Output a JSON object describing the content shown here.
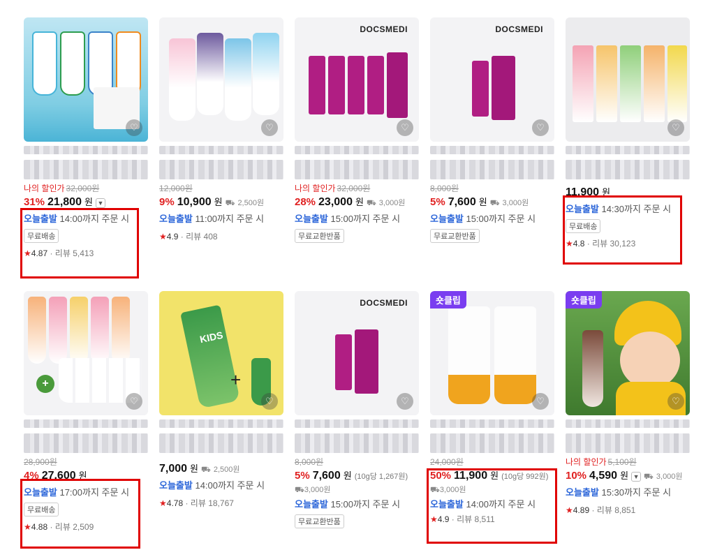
{
  "colors": {
    "discount": "#e02020",
    "today_shipping": "#2c66d9",
    "highlight": "#e00000",
    "sale_badge": "#7a3df0"
  },
  "icons": {
    "favorite": "heart-icon",
    "rating": "star-icon",
    "shipping_fee": "truck-icon",
    "option": "chevron-down-icon"
  },
  "products": [
    {
      "orig_label": "나의 할인가",
      "orig_price": "32,000원",
      "discount": "31%",
      "price": "21,800",
      "won": "원",
      "today_tag": "오늘출발",
      "today_text": "14:00까지 주문 시",
      "chip": "무료배송",
      "star": "★",
      "rating": "4.87",
      "reviews": "리뷰 5,413"
    },
    {
      "orig_price": "12,000원",
      "discount": "9%",
      "price": "10,900",
      "won": "원",
      "shipping": "2,500원",
      "today_tag": "오늘출발",
      "today_text": "11:00까지 주문 시",
      "star": "★",
      "rating": "4.9",
      "reviews": "리뷰 408"
    },
    {
      "brand": "DOCSMEDI",
      "orig_label": "나의 할인가",
      "orig_price": "32,000원",
      "discount": "28%",
      "price": "23,000",
      "won": "원",
      "shipping": "3,000원",
      "today_tag": "오늘출발",
      "today_text": "15:00까지 주문 시",
      "chip": "무료교환반품"
    },
    {
      "brand": "DOCSMEDI",
      "orig_price": "8,000원",
      "discount": "5%",
      "price": "7,600",
      "won": "원",
      "shipping": "3,000원",
      "today_tag": "오늘출발",
      "today_text": "15:00까지 주문 시",
      "chip": "무료교환반품"
    },
    {
      "price": "11,900",
      "won": "원",
      "today_tag": "오늘출발",
      "today_text": "14:30까지 주문 시",
      "chip": "무료배송",
      "star": "★",
      "rating": "4.8",
      "reviews": "리뷰 30,123"
    },
    {
      "orig_price": "28,900원",
      "discount": "4%",
      "price": "27,600",
      "won": "원",
      "today_tag": "오늘출발",
      "today_text": "17:00까지 주문 시",
      "chip": "무료배송",
      "star": "★",
      "rating": "4.88",
      "reviews": "리뷰 2,509"
    },
    {
      "price": "7,000",
      "won": "원",
      "shipping": "2,500원",
      "today_tag": "오늘출발",
      "today_text": "14:00까지 주문 시",
      "star": "★",
      "rating": "4.78",
      "reviews": "리뷰 18,767",
      "kids": "KIDS",
      "plus": "+"
    },
    {
      "brand": "DOCSMEDI",
      "orig_price": "8,000원",
      "discount": "5%",
      "price": "7,600",
      "won": "원",
      "unit": "(10g당 1,267원)",
      "shipping": "3,000원",
      "today_tag": "오늘출발",
      "today_text": "15:00까지 주문 시",
      "chip": "무료교환반품"
    },
    {
      "badge": "숏클립",
      "orig_price": "24,000원",
      "discount": "50%",
      "price": "11,900",
      "won": "원",
      "unit": "(10g당 992원)",
      "shipping": "3,000원",
      "today_tag": "오늘출발",
      "today_text": "14:00까지 주문 시",
      "star": "★",
      "rating": "4.9",
      "reviews": "리뷰 8,511"
    },
    {
      "badge": "숏클립",
      "orig_label": "나의 할인가",
      "orig_price": "5,100원",
      "discount": "10%",
      "price": "4,590",
      "won": "원",
      "shipping": "3,000원",
      "today_tag": "오늘출발",
      "today_text": "15:30까지 주문 시",
      "star": "★",
      "rating": "4.89",
      "reviews": "리뷰 8,851"
    }
  ]
}
